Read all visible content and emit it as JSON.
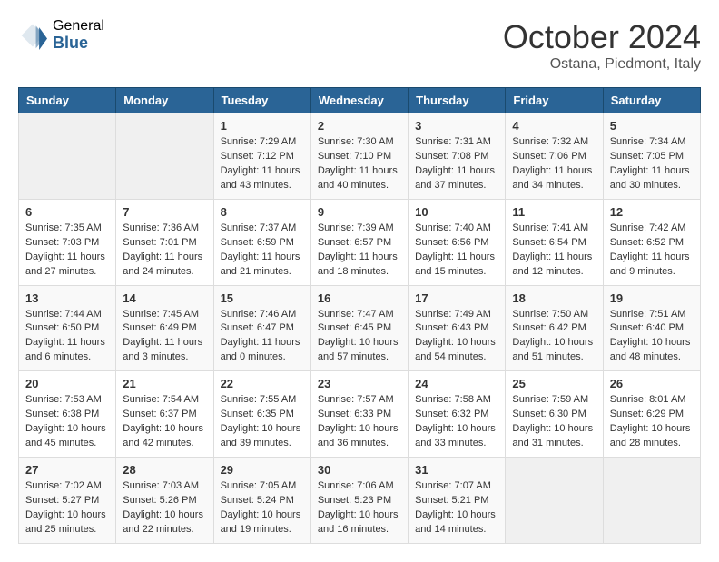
{
  "header": {
    "logo_general": "General",
    "logo_blue": "Blue",
    "month_year": "October 2024",
    "location": "Ostana, Piedmont, Italy"
  },
  "weekdays": [
    "Sunday",
    "Monday",
    "Tuesday",
    "Wednesday",
    "Thursday",
    "Friday",
    "Saturday"
  ],
  "weeks": [
    [
      {
        "day": "",
        "empty": true
      },
      {
        "day": "",
        "empty": true
      },
      {
        "day": "1",
        "sunrise": "Sunrise: 7:29 AM",
        "sunset": "Sunset: 7:12 PM",
        "daylight": "Daylight: 11 hours and 43 minutes."
      },
      {
        "day": "2",
        "sunrise": "Sunrise: 7:30 AM",
        "sunset": "Sunset: 7:10 PM",
        "daylight": "Daylight: 11 hours and 40 minutes."
      },
      {
        "day": "3",
        "sunrise": "Sunrise: 7:31 AM",
        "sunset": "Sunset: 7:08 PM",
        "daylight": "Daylight: 11 hours and 37 minutes."
      },
      {
        "day": "4",
        "sunrise": "Sunrise: 7:32 AM",
        "sunset": "Sunset: 7:06 PM",
        "daylight": "Daylight: 11 hours and 34 minutes."
      },
      {
        "day": "5",
        "sunrise": "Sunrise: 7:34 AM",
        "sunset": "Sunset: 7:05 PM",
        "daylight": "Daylight: 11 hours and 30 minutes."
      }
    ],
    [
      {
        "day": "6",
        "sunrise": "Sunrise: 7:35 AM",
        "sunset": "Sunset: 7:03 PM",
        "daylight": "Daylight: 11 hours and 27 minutes."
      },
      {
        "day": "7",
        "sunrise": "Sunrise: 7:36 AM",
        "sunset": "Sunset: 7:01 PM",
        "daylight": "Daylight: 11 hours and 24 minutes."
      },
      {
        "day": "8",
        "sunrise": "Sunrise: 7:37 AM",
        "sunset": "Sunset: 6:59 PM",
        "daylight": "Daylight: 11 hours and 21 minutes."
      },
      {
        "day": "9",
        "sunrise": "Sunrise: 7:39 AM",
        "sunset": "Sunset: 6:57 PM",
        "daylight": "Daylight: 11 hours and 18 minutes."
      },
      {
        "day": "10",
        "sunrise": "Sunrise: 7:40 AM",
        "sunset": "Sunset: 6:56 PM",
        "daylight": "Daylight: 11 hours and 15 minutes."
      },
      {
        "day": "11",
        "sunrise": "Sunrise: 7:41 AM",
        "sunset": "Sunset: 6:54 PM",
        "daylight": "Daylight: 11 hours and 12 minutes."
      },
      {
        "day": "12",
        "sunrise": "Sunrise: 7:42 AM",
        "sunset": "Sunset: 6:52 PM",
        "daylight": "Daylight: 11 hours and 9 minutes."
      }
    ],
    [
      {
        "day": "13",
        "sunrise": "Sunrise: 7:44 AM",
        "sunset": "Sunset: 6:50 PM",
        "daylight": "Daylight: 11 hours and 6 minutes."
      },
      {
        "day": "14",
        "sunrise": "Sunrise: 7:45 AM",
        "sunset": "Sunset: 6:49 PM",
        "daylight": "Daylight: 11 hours and 3 minutes."
      },
      {
        "day": "15",
        "sunrise": "Sunrise: 7:46 AM",
        "sunset": "Sunset: 6:47 PM",
        "daylight": "Daylight: 11 hours and 0 minutes."
      },
      {
        "day": "16",
        "sunrise": "Sunrise: 7:47 AM",
        "sunset": "Sunset: 6:45 PM",
        "daylight": "Daylight: 10 hours and 57 minutes."
      },
      {
        "day": "17",
        "sunrise": "Sunrise: 7:49 AM",
        "sunset": "Sunset: 6:43 PM",
        "daylight": "Daylight: 10 hours and 54 minutes."
      },
      {
        "day": "18",
        "sunrise": "Sunrise: 7:50 AM",
        "sunset": "Sunset: 6:42 PM",
        "daylight": "Daylight: 10 hours and 51 minutes."
      },
      {
        "day": "19",
        "sunrise": "Sunrise: 7:51 AM",
        "sunset": "Sunset: 6:40 PM",
        "daylight": "Daylight: 10 hours and 48 minutes."
      }
    ],
    [
      {
        "day": "20",
        "sunrise": "Sunrise: 7:53 AM",
        "sunset": "Sunset: 6:38 PM",
        "daylight": "Daylight: 10 hours and 45 minutes."
      },
      {
        "day": "21",
        "sunrise": "Sunrise: 7:54 AM",
        "sunset": "Sunset: 6:37 PM",
        "daylight": "Daylight: 10 hours and 42 minutes."
      },
      {
        "day": "22",
        "sunrise": "Sunrise: 7:55 AM",
        "sunset": "Sunset: 6:35 PM",
        "daylight": "Daylight: 10 hours and 39 minutes."
      },
      {
        "day": "23",
        "sunrise": "Sunrise: 7:57 AM",
        "sunset": "Sunset: 6:33 PM",
        "daylight": "Daylight: 10 hours and 36 minutes."
      },
      {
        "day": "24",
        "sunrise": "Sunrise: 7:58 AM",
        "sunset": "Sunset: 6:32 PM",
        "daylight": "Daylight: 10 hours and 33 minutes."
      },
      {
        "day": "25",
        "sunrise": "Sunrise: 7:59 AM",
        "sunset": "Sunset: 6:30 PM",
        "daylight": "Daylight: 10 hours and 31 minutes."
      },
      {
        "day": "26",
        "sunrise": "Sunrise: 8:01 AM",
        "sunset": "Sunset: 6:29 PM",
        "daylight": "Daylight: 10 hours and 28 minutes."
      }
    ],
    [
      {
        "day": "27",
        "sunrise": "Sunrise: 7:02 AM",
        "sunset": "Sunset: 5:27 PM",
        "daylight": "Daylight: 10 hours and 25 minutes."
      },
      {
        "day": "28",
        "sunrise": "Sunrise: 7:03 AM",
        "sunset": "Sunset: 5:26 PM",
        "daylight": "Daylight: 10 hours and 22 minutes."
      },
      {
        "day": "29",
        "sunrise": "Sunrise: 7:05 AM",
        "sunset": "Sunset: 5:24 PM",
        "daylight": "Daylight: 10 hours and 19 minutes."
      },
      {
        "day": "30",
        "sunrise": "Sunrise: 7:06 AM",
        "sunset": "Sunset: 5:23 PM",
        "daylight": "Daylight: 10 hours and 16 minutes."
      },
      {
        "day": "31",
        "sunrise": "Sunrise: 7:07 AM",
        "sunset": "Sunset: 5:21 PM",
        "daylight": "Daylight: 10 hours and 14 minutes."
      },
      {
        "day": "",
        "empty": true
      },
      {
        "day": "",
        "empty": true
      }
    ]
  ]
}
